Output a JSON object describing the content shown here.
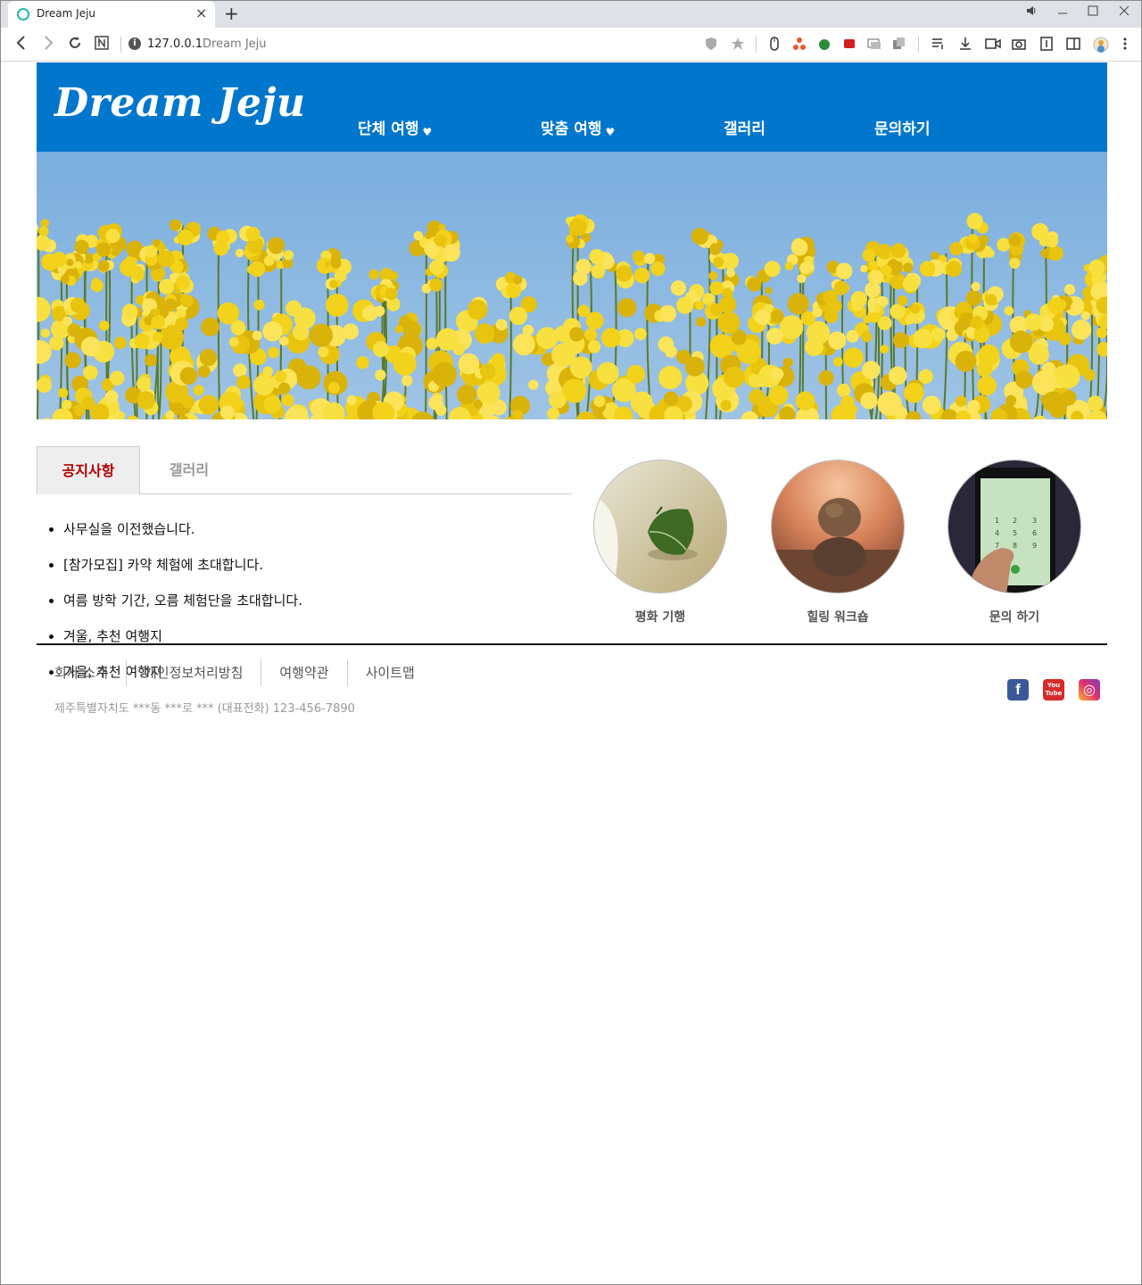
{
  "browser": {
    "tab_title": "Dream Jeju",
    "tab_close": "×",
    "new_tab": "+",
    "url_host": "127.0.0.1",
    "url_title": "Dream Jeju"
  },
  "site": {
    "logo": "Dream Jeju",
    "nav": [
      {
        "label": "단체 여행",
        "arrow": "♥"
      },
      {
        "label": "맞춤 여행",
        "arrow": "♥"
      },
      {
        "label": "갤러리"
      },
      {
        "label": "문의하기"
      }
    ]
  },
  "board": {
    "tabs": [
      {
        "label": "공지사항"
      },
      {
        "label": "갤러리"
      }
    ],
    "notices": [
      "사무실을 이전했습니다.",
      "[참가모집] 카약 체험에 초대합니다.",
      "여름 방학 기간, 오름 체험단을 초대합니다.",
      "겨울, 추천 여행지",
      "가을, 추천 여행지"
    ]
  },
  "quick_links": [
    {
      "label": "평화 기행"
    },
    {
      "label": "힐링 워크숍"
    },
    {
      "label": "문의 하기"
    }
  ],
  "footer": {
    "links": [
      "회사 소개",
      "개인정보처리방침",
      "여행약관",
      "사이트맵"
    ],
    "address": "제주특별자치도 ***동 ***로 *** (대표전화) 123-456-7890",
    "sns": [
      {
        "icon": "facebook-icon",
        "glyph": "f",
        "color": "#3b5998"
      },
      {
        "icon": "youtube-icon",
        "glyph": "You Tube",
        "color": "#d62b2b"
      },
      {
        "icon": "instagram-icon",
        "glyph": "◎",
        "color": "#c13584"
      }
    ]
  },
  "colors": {
    "header_bg": "#0077cc",
    "active_tab_text": "#b00000"
  }
}
